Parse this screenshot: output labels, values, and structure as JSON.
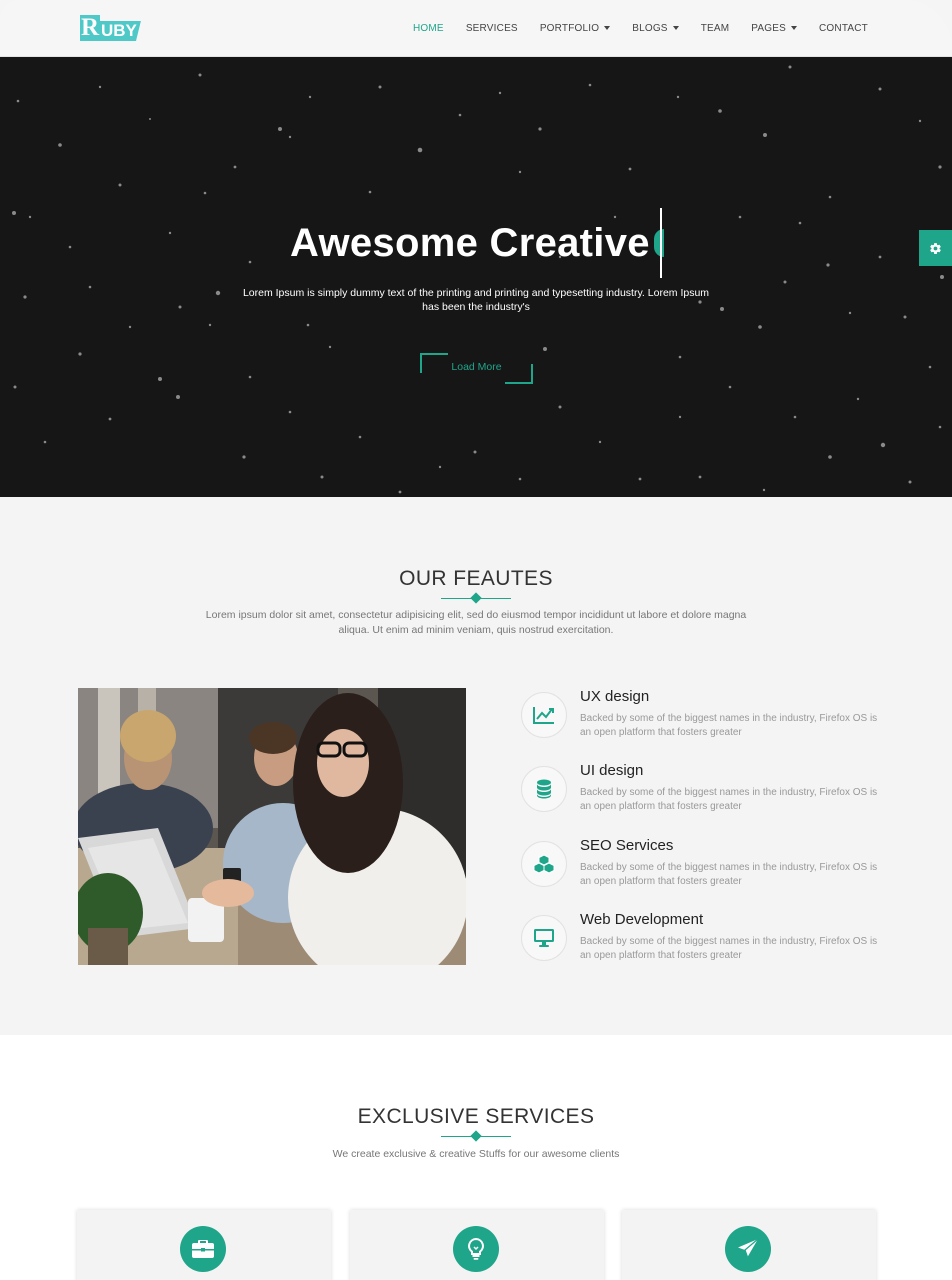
{
  "brand": {
    "logo_initial": "R",
    "logo_rest": "UBY"
  },
  "nav": {
    "items": [
      {
        "label": "HOME",
        "active": true,
        "has_caret": false
      },
      {
        "label": "SERVICES",
        "active": false,
        "has_caret": false
      },
      {
        "label": "PORTFOLIO",
        "active": false,
        "has_caret": true
      },
      {
        "label": "BLOGS",
        "active": false,
        "has_caret": true
      },
      {
        "label": "TEAM",
        "active": false,
        "has_caret": false
      },
      {
        "label": "PAGES",
        "active": false,
        "has_caret": true
      },
      {
        "label": "CONTACT",
        "active": false,
        "has_caret": false
      }
    ]
  },
  "hero": {
    "title": "Awesome Creative",
    "text": "Lorem Ipsum is simply dummy text of the printing and printing and typesetting industry. Lorem Ipsum has been the industry's",
    "button": "Load More"
  },
  "settings": {
    "icon": "gear-icon"
  },
  "features": {
    "title": "OUR FEAUTES",
    "subtitle": "Lorem ipsum dolor sit amet, consectetur adipisicing elit, sed do eiusmod tempor incididunt ut labore et dolore magna aliqua. Ut enim ad minim veniam, quis nostrud exercitation.",
    "items": [
      {
        "title": "UX design",
        "text": "Backed by some of the biggest names in the industry, Firefox OS is an open platform that fosters greater",
        "icon": "line-chart-icon"
      },
      {
        "title": "UI design",
        "text": "Backed by some of the biggest names in the industry, Firefox OS is an open platform that fosters greater",
        "icon": "database-icon"
      },
      {
        "title": "SEO Services",
        "text": "Backed by some of the biggest names in the industry, Firefox OS is an open platform that fosters greater",
        "icon": "cubes-icon"
      },
      {
        "title": "Web Development",
        "text": "Backed by some of the biggest names in the industry, Firefox OS is an open platform that fosters greater",
        "icon": "desktop-icon"
      }
    ]
  },
  "services": {
    "title": "EXCLUSIVE SERVICES",
    "subtitle": "We create exclusive & creative Stuffs for our awesome clients",
    "cards": [
      {
        "icon": "briefcase-icon"
      },
      {
        "icon": "lightbulb-icon"
      },
      {
        "icon": "paper-plane-icon"
      }
    ]
  },
  "colors": {
    "accent": "#1fa58a",
    "logo": "#4ec9c8",
    "hero_bg": "#161617"
  }
}
